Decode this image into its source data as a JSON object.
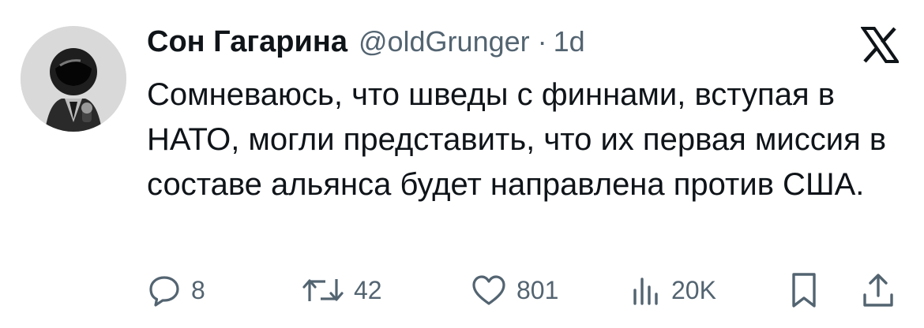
{
  "tweet": {
    "display_name": "Сон Гагарина",
    "handle": "@oldGrunger",
    "separator": "·",
    "time": "1d",
    "text": "Сомневаюсь, что шведы с финнами, вступая в НАТО, могли представить, что их первая миссия в составе альянса будет направлена против США."
  },
  "actions": {
    "replies": "8",
    "reposts": "42",
    "likes": "801",
    "views": "20K"
  },
  "icons": {
    "platform": "x-logo-icon",
    "reply": "reply-icon",
    "repost": "repost-icon",
    "like": "heart-icon",
    "views": "views-icon",
    "bookmark": "bookmark-icon",
    "share": "share-icon"
  },
  "colors": {
    "text_primary": "#0f1419",
    "text_secondary": "#536471",
    "background": "#ffffff"
  }
}
